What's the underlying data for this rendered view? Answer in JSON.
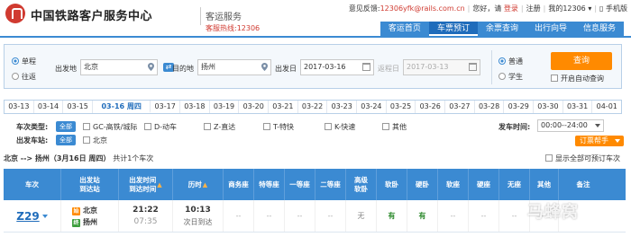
{
  "header": {
    "logo_text": "中国铁路客户服务中心",
    "service_name": "客运服务",
    "hotline": "客服热线:12306",
    "feedback_label": "意见反馈:",
    "feedback_email": "12306yfk@rails.com.cn",
    "welcome": "您好，请",
    "login": "登录",
    "register": "注册",
    "my12306": "我的12306",
    "phone": "手机版"
  },
  "mainnav": [
    "客运首页",
    "车票预订",
    "余票查询",
    "出行向导",
    "信息服务"
  ],
  "search": {
    "trip_type": [
      "单程",
      "往返"
    ],
    "from_label": "出发地",
    "from_value": "北京",
    "to_label": "目的地",
    "to_value": "扬州",
    "depart_label": "出发日",
    "depart_value": "2017-03-16",
    "return_label": "返程日",
    "return_value": "2017-03-13",
    "ticket_type": [
      "普通",
      "学生"
    ],
    "query_button": "查询",
    "auto_query": "开启自动查询"
  },
  "datebar": [
    "03-13",
    "03-14",
    "03-15",
    "03-16 周四",
    "03-17",
    "03-18",
    "03-19",
    "03-20",
    "03-21",
    "03-22",
    "03-23",
    "03-24",
    "03-25",
    "03-26",
    "03-27",
    "03-28",
    "03-29",
    "03-30",
    "03-31",
    "04-01"
  ],
  "filters": {
    "train_type_label": "车次类型:",
    "all_label": "全部",
    "train_types": [
      "GC-高铁/城际",
      "D-动车",
      "Z-直达",
      "T-特快",
      "K-快速",
      "其他"
    ],
    "station_label": "出发车站:",
    "stations": [
      "北京"
    ],
    "depart_time_label": "发车时间:",
    "depart_time_value": "00:00--24:00",
    "help_button": "订票帮手"
  },
  "summary": {
    "route": "北京 --> 扬州（3月16日 周四）",
    "count": "共计1个车次",
    "show_all": "显示全部可预订车次"
  },
  "table": {
    "headers": [
      "车次",
      "出发站\n到达站",
      "出发时间\n到达时间",
      "历时",
      "商务座",
      "特等座",
      "一等座",
      "二等座",
      "高级\n软卧",
      "软卧",
      "硬卧",
      "软座",
      "硬座",
      "无座",
      "其他",
      "备注"
    ],
    "rows": [
      {
        "train": "Z29",
        "from": "北京",
        "to": "扬州",
        "from_badge": "始",
        "to_badge": "终",
        "dep": "21:22",
        "arr": "07:35",
        "duration": "10:13",
        "arrive_day": "次日到达",
        "seats": [
          "--",
          "--",
          "--",
          "--",
          "无",
          "有",
          "有",
          "--",
          "--",
          "--",
          "--"
        ]
      }
    ]
  },
  "watermark": "马蜂窝",
  "colors": {
    "primary_blue": "#3b8ad2",
    "accent_orange": "#ff8a00",
    "brand_red": "#d03a30",
    "available_green": "#2e8b2e"
  }
}
